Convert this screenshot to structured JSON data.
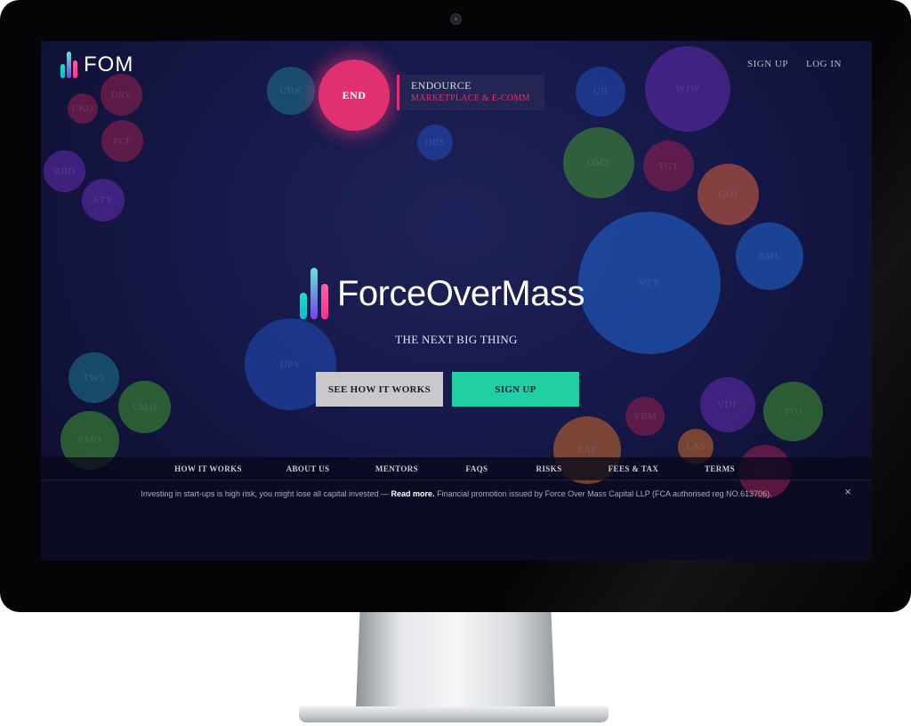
{
  "header": {
    "logo_text": "FOM",
    "nav": {
      "signup": "SIGN UP",
      "login": "LOG IN"
    }
  },
  "tooltip": {
    "name": "ENDOURCE",
    "category": "MARKETPLACE & E-COMM"
  },
  "bubbles": [
    {
      "label": "DRV",
      "color": "#8a1f4e"
    },
    {
      "label": "CKO",
      "color": "#8a1f4e"
    },
    {
      "label": "PCF",
      "color": "#8a1f4e"
    },
    {
      "label": "RBD",
      "color": "#5a2aa6"
    },
    {
      "label": "STY",
      "color": "#5a2aa6"
    },
    {
      "label": "UDK",
      "color": "#1b6d86"
    },
    {
      "label": "END",
      "color": "#e0306f"
    },
    {
      "label": "OBS",
      "color": "#1f48b0"
    },
    {
      "label": "UB",
      "color": "#1f48b0"
    },
    {
      "label": "WJW",
      "color": "#5a2aa6"
    },
    {
      "label": "OMT",
      "color": "#3c8a33"
    },
    {
      "label": "TGT",
      "color": "#8a1f4e"
    },
    {
      "label": "GOJ",
      "color": "#c55a3d"
    },
    {
      "label": "BML",
      "color": "#1f5fc6"
    },
    {
      "label": "VTY",
      "color": "#1f5fc6"
    },
    {
      "label": "DPY",
      "color": "#1f48b0"
    },
    {
      "label": "TWS",
      "color": "#1b6d86"
    },
    {
      "label": "CMD",
      "color": "#3c8a33"
    },
    {
      "label": "EMO",
      "color": "#3c8a33"
    },
    {
      "label": "YBM",
      "color": "#8a1f4e"
    },
    {
      "label": "VDF",
      "color": "#5a2aa6"
    },
    {
      "label": "TDJ",
      "color": "#3c8a33"
    },
    {
      "label": "EAT",
      "color": "#b8622e"
    },
    {
      "label": "LAS",
      "color": "#b8622e"
    },
    {
      "label": "MRC",
      "color": "#8a1f4e"
    }
  ],
  "hero": {
    "title": "ForceOverMass",
    "tagline": "THE NEXT BIG THING",
    "btn_how": "SEE HOW IT WORKS",
    "btn_signup": "SIGN UP"
  },
  "footer_nav": [
    "HOW IT WORKS",
    "ABOUT US",
    "MENTORS",
    "FAQS",
    "RISKS",
    "FEES & TAX",
    "TERMS"
  ],
  "notice": {
    "text_before": "Investing in start-ups is high risk, you might lose all capital invested —",
    "link": "Read more.",
    "text_after": "Financial promotion issued by Force Over Mass Capital LLP (FCA authorised reg NO.613706).",
    "close": "×"
  },
  "colors": {
    "accent_teal": "#20cfa2",
    "accent_pink": "#e0306f",
    "logo_gradient": [
      "#18e0c2",
      "#7b3cf0",
      "#ff2f8a"
    ]
  }
}
